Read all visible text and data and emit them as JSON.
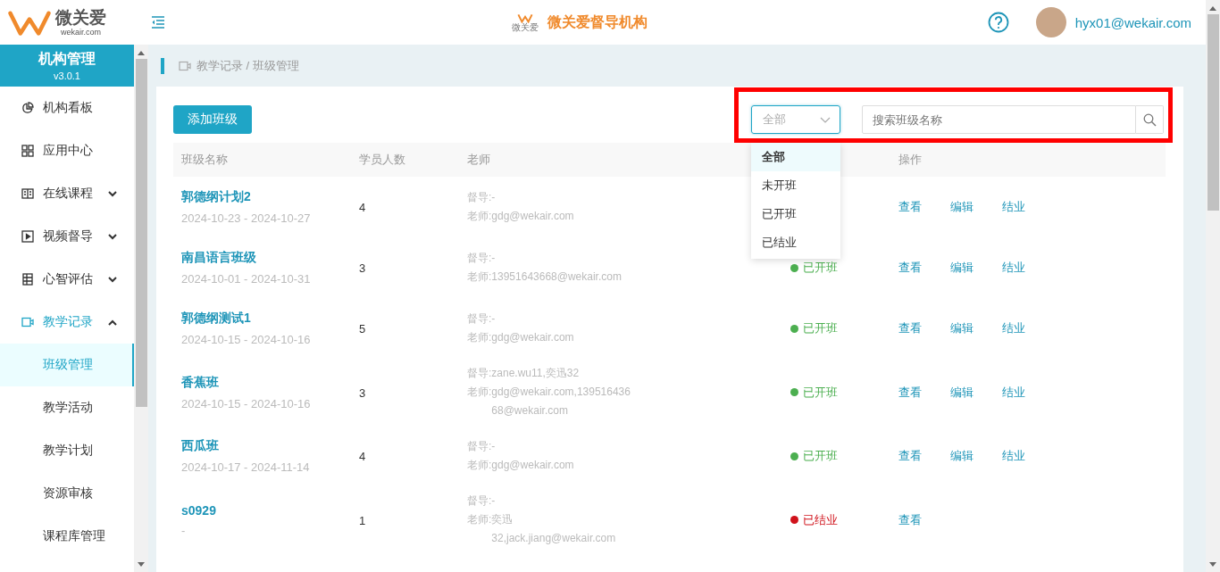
{
  "header": {
    "brand_name": "微关爱",
    "brand_domain": "wekair.com",
    "center_logo_text": "微关爱",
    "title": "微关爱督导机构",
    "user": "hyx01@wekair.com"
  },
  "sidebar": {
    "title": "机构管理",
    "version": "v3.0.1",
    "items": [
      {
        "label": "机构看板",
        "selected": false
      },
      {
        "label": "应用中心",
        "selected": false
      },
      {
        "label": "在线课程",
        "expanded": false,
        "selected": false
      },
      {
        "label": "视频督导",
        "expanded": false,
        "selected": false
      },
      {
        "label": "心智评估",
        "expanded": false,
        "selected": false
      },
      {
        "label": "教学记录",
        "expanded": true,
        "selected": true,
        "children": [
          {
            "label": "班级管理",
            "selected": true
          },
          {
            "label": "教学活动",
            "selected": false
          },
          {
            "label": "教学计划",
            "selected": false
          },
          {
            "label": "资源审核",
            "selected": false
          },
          {
            "label": "课程库管理",
            "selected": false
          }
        ]
      }
    ]
  },
  "breadcrumb": "教学记录 / 班级管理",
  "toolbar": {
    "add_button": "添加班级",
    "filter": {
      "value": "全部",
      "open": true,
      "options": [
        {
          "label": "全部",
          "selected": true
        },
        {
          "label": "未开班",
          "selected": false
        },
        {
          "label": "已开班",
          "selected": false
        },
        {
          "label": "已结业",
          "selected": false
        }
      ]
    },
    "search": {
      "placeholder": "搜索班级名称"
    },
    "highlighted": true
  },
  "table": {
    "columns": [
      "班级名称",
      "学员人数",
      "老师",
      "操作"
    ],
    "rows": [
      {
        "name": "郭德纲计划2",
        "dates": "2024-10-23 - 2024-10-27",
        "count": "4",
        "supervisor": {
          "label": "督导:",
          "value": "-"
        },
        "teacher": {
          "label": "老师:",
          "value": "gdg@wekair.com"
        },
        "actions": [
          "查看",
          "编辑",
          "结业"
        ]
      },
      {
        "name": "南昌语言班级",
        "dates": "2024-10-01 - 2024-10-31",
        "count": "3",
        "supervisor": {
          "label": "督导:",
          "value": "-"
        },
        "teacher": {
          "label": "老师:",
          "value": "13951643668@wekair.com"
        },
        "status": {
          "label": "已开班",
          "color": "#4caf50"
        },
        "actions": [
          "查看",
          "编辑",
          "结业"
        ]
      },
      {
        "name": "郭德纲测试1",
        "dates": "2024-10-15 - 2024-10-16",
        "count": "5",
        "supervisor": {
          "label": "督导:",
          "value": "-"
        },
        "teacher": {
          "label": "老师:",
          "value": "gdg@wekair.com"
        },
        "status": {
          "label": "已开班",
          "color": "#4caf50"
        },
        "actions": [
          "查看",
          "编辑",
          "结业"
        ]
      },
      {
        "name": "香蕉班",
        "dates": "2024-10-15 - 2024-10-16",
        "count": "3",
        "supervisor": {
          "label": "督导:",
          "value": "zane.wu11,奕迅32"
        },
        "teacher": {
          "label": "老师:",
          "value": "gdg@wekair.com,13951643668@wekair.com"
        },
        "status": {
          "label": "已开班",
          "color": "#4caf50"
        },
        "actions": [
          "查看",
          "编辑",
          "结业"
        ]
      },
      {
        "name": "西瓜班",
        "dates": "2024-10-17 - 2024-11-14",
        "count": "4",
        "supervisor": {
          "label": "督导:",
          "value": "-"
        },
        "teacher": {
          "label": "老师:",
          "value": "gdg@wekair.com"
        },
        "status": {
          "label": "已开班",
          "color": "#4caf50"
        },
        "actions": [
          "查看",
          "编辑",
          "结业"
        ]
      },
      {
        "name": "s0929",
        "dates": "-",
        "count": "1",
        "supervisor": {
          "label": "督导:",
          "value": "-"
        },
        "teacher": {
          "label": "老师:",
          "value": "奕迅32,jack.jiang@wekair.com"
        },
        "status": {
          "label": "已结业",
          "color": "#d0121b"
        },
        "actions": [
          "查看"
        ]
      }
    ]
  }
}
